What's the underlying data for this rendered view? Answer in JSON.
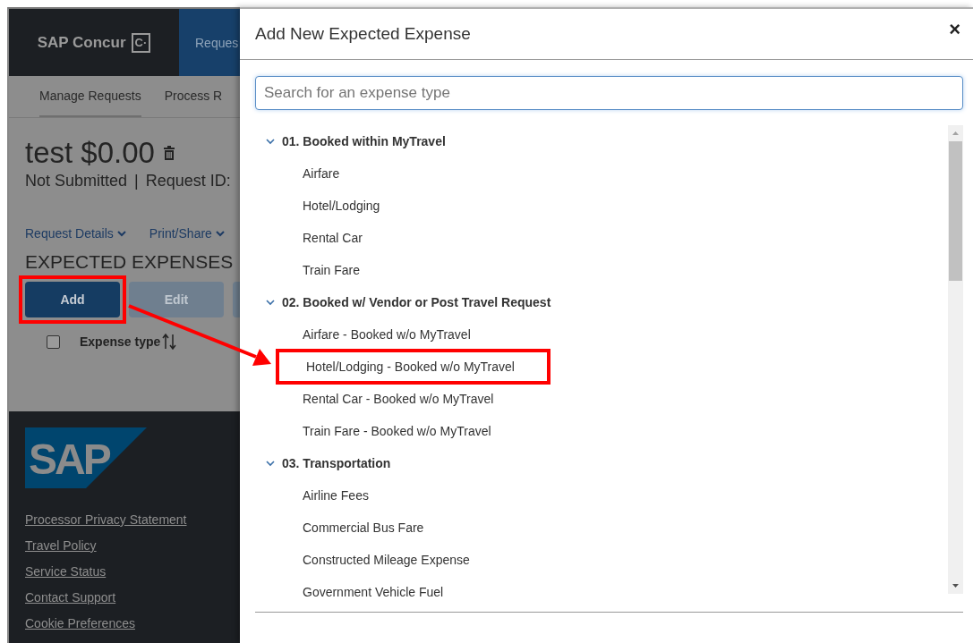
{
  "page": {
    "brand": "SAP Concur",
    "brand_mark": "C·",
    "nav_tab": "Reques",
    "subnav": [
      {
        "label": "Manage Requests",
        "selected": true
      },
      {
        "label": "Process R",
        "selected": false
      }
    ],
    "request_title": "test $0.00",
    "status": "Not Submitted",
    "separator": "|",
    "request_id": "Request ID: ",
    "actions": [
      "Request Details",
      "Print/Share"
    ],
    "section_title": "EXPECTED EXPENSES",
    "buttons": [
      {
        "label": "Add",
        "disabled": false,
        "highlighted": true
      },
      {
        "label": "Edit",
        "disabled": true,
        "highlighted": false
      },
      {
        "disabled": true,
        "highlighted": false
      }
    ],
    "table_header": {
      "checked": false,
      "column": "Expense type"
    },
    "footer_logo": "SAP",
    "footer_links": [
      "Processor Privacy Statement",
      "Travel Policy",
      "Service Status",
      "Contact Support",
      "Cookie Preferences"
    ]
  },
  "modal": {
    "title": "Add New Expected Expense",
    "close": "×",
    "search": {
      "placeholder": "Search for an expense type"
    },
    "groups": [
      {
        "label": "01. Booked within MyTravel",
        "expanded": true,
        "children": [
          {
            "label": "Airfare",
            "highlighted": false
          },
          {
            "label": "Hotel/Lodging",
            "highlighted": false
          },
          {
            "label": "Rental Car",
            "highlighted": false
          },
          {
            "label": "Train Fare",
            "highlighted": false
          }
        ]
      },
      {
        "label": "02. Booked w/ Vendor or Post Travel Request",
        "expanded": true,
        "children": [
          {
            "label": "Airfare - Booked w/o MyTravel",
            "highlighted": false
          },
          {
            "label": "Hotel/Lodging - Booked w/o MyTravel",
            "highlighted": true
          },
          {
            "label": "Rental Car - Booked w/o MyTravel",
            "highlighted": false
          },
          {
            "label": "Train Fare - Booked w/o MyTravel",
            "highlighted": false
          }
        ]
      },
      {
        "label": "03. Transportation",
        "expanded": true,
        "children": [
          {
            "label": "Airline Fees",
            "highlighted": false
          },
          {
            "label": "Commercial Bus Fare",
            "highlighted": false
          },
          {
            "label": "Constructed Mileage Expense",
            "highlighted": false
          },
          {
            "label": "Government Vehicle Fuel",
            "highlighted": false
          }
        ]
      }
    ]
  }
}
